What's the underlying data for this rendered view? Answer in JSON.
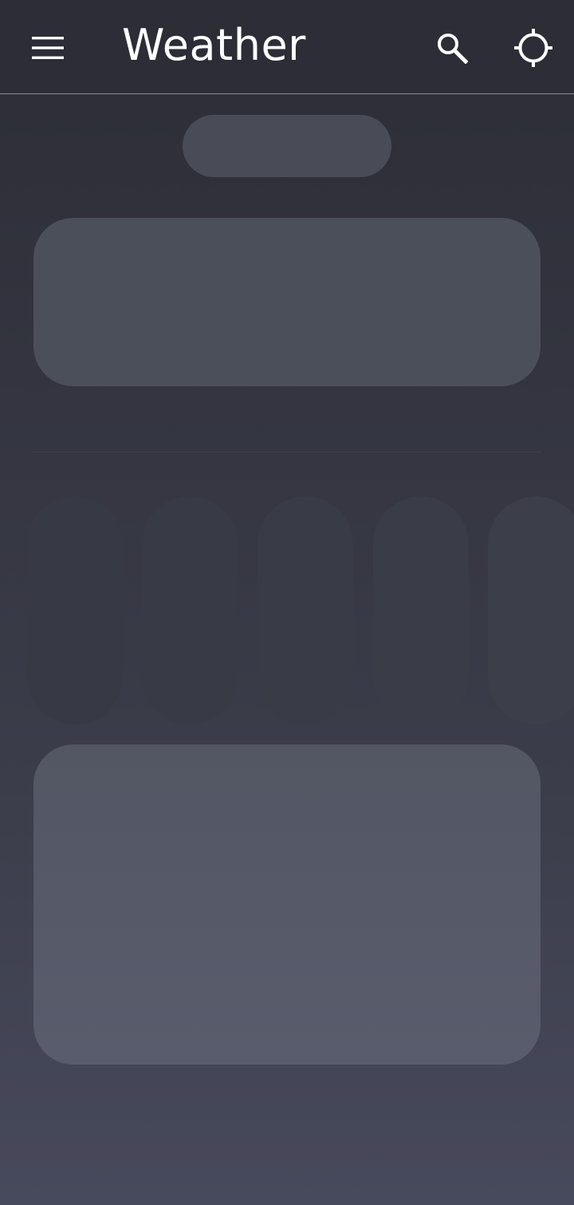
{
  "header": {
    "title": "Weather",
    "menu_icon": "menu-icon",
    "search_icon": "search-icon",
    "location_icon": "gps-location-icon"
  },
  "colors": {
    "background_top": "#2c2d36",
    "background_bottom": "#474a5c",
    "text": "#ffffff",
    "header_border": "#8a8b93",
    "skeleton": "#4b4f5a"
  },
  "loading_state": {
    "is_loading": true,
    "hourly_placeholders": 5
  }
}
